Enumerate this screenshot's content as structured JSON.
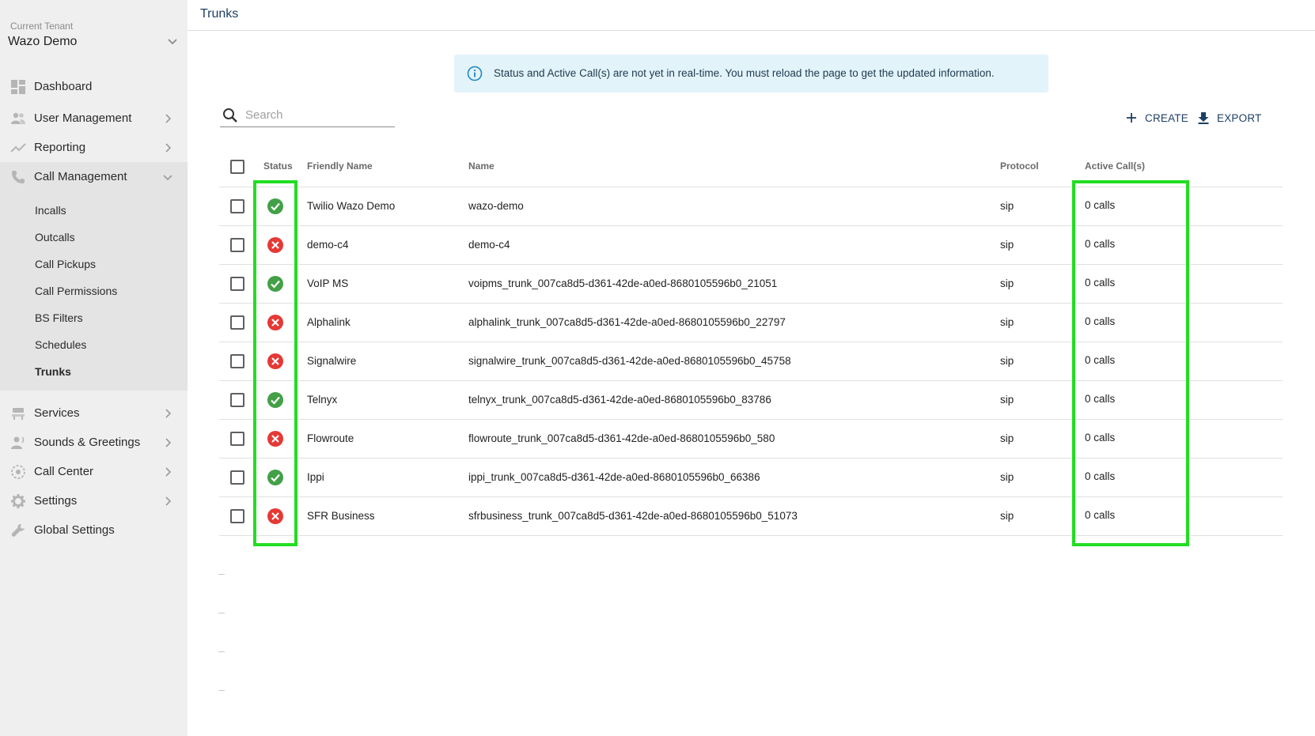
{
  "sidebar": {
    "tenant_caption": "Current Tenant",
    "tenant_name": "Wazo Demo",
    "items": [
      {
        "label": "Dashboard"
      },
      {
        "label": "User Management"
      },
      {
        "label": "Reporting"
      },
      {
        "label": "Call Management"
      },
      {
        "label": "Services"
      },
      {
        "label": "Sounds & Greetings"
      },
      {
        "label": "Call Center"
      },
      {
        "label": "Settings"
      },
      {
        "label": "Global Settings"
      }
    ],
    "call_management_sub": [
      {
        "label": "Incalls"
      },
      {
        "label": "Outcalls"
      },
      {
        "label": "Call Pickups"
      },
      {
        "label": "Call Permissions"
      },
      {
        "label": "BS Filters"
      },
      {
        "label": "Schedules"
      },
      {
        "label": "Trunks"
      }
    ]
  },
  "header": {
    "title": "Trunks"
  },
  "notice": {
    "text": "Status and Active Call(s) are not yet in real-time. You must reload the page to get the updated information."
  },
  "search": {
    "placeholder": "Search",
    "value": ""
  },
  "actions": {
    "create": "CREATE",
    "export": "EXPORT"
  },
  "table": {
    "columns": [
      "Status",
      "Friendly Name",
      "Name",
      "Protocol",
      "Active Call(s)"
    ],
    "rows": [
      {
        "status": "ok",
        "friendly_name": "Twilio Wazo Demo",
        "name": "wazo-demo",
        "protocol": "sip",
        "active_calls": "0 calls"
      },
      {
        "status": "error",
        "friendly_name": "demo-c4",
        "name": "demo-c4",
        "protocol": "sip",
        "active_calls": "0 calls"
      },
      {
        "status": "ok",
        "friendly_name": "VoIP MS",
        "name": "voipms_trunk_007ca8d5-d361-42de-a0ed-8680105596b0_21051",
        "protocol": "sip",
        "active_calls": "0 calls"
      },
      {
        "status": "error",
        "friendly_name": "Alphalink",
        "name": "alphalink_trunk_007ca8d5-d361-42de-a0ed-8680105596b0_22797",
        "protocol": "sip",
        "active_calls": "0 calls"
      },
      {
        "status": "error",
        "friendly_name": "Signalwire",
        "name": "signalwire_trunk_007ca8d5-d361-42de-a0ed-8680105596b0_45758",
        "protocol": "sip",
        "active_calls": "0 calls"
      },
      {
        "status": "ok",
        "friendly_name": "Telnyx",
        "name": "telnyx_trunk_007ca8d5-d361-42de-a0ed-8680105596b0_83786",
        "protocol": "sip",
        "active_calls": "0 calls"
      },
      {
        "status": "error",
        "friendly_name": "Flowroute",
        "name": "flowroute_trunk_007ca8d5-d361-42de-a0ed-8680105596b0_580",
        "protocol": "sip",
        "active_calls": "0 calls"
      },
      {
        "status": "ok",
        "friendly_name": "Ippi",
        "name": "ippi_trunk_007ca8d5-d361-42de-a0ed-8680105596b0_66386",
        "protocol": "sip",
        "active_calls": "0 calls"
      },
      {
        "status": "error",
        "friendly_name": "SFR Business",
        "name": "sfrbusiness_trunk_007ca8d5-d361-42de-a0ed-8680105596b0_51073",
        "protocol": "sip",
        "active_calls": "0 calls"
      }
    ]
  },
  "colors": {
    "status_ok": "#43a047",
    "status_error": "#e53935",
    "highlight": "#22dd22",
    "accent": "#1d3f63"
  }
}
